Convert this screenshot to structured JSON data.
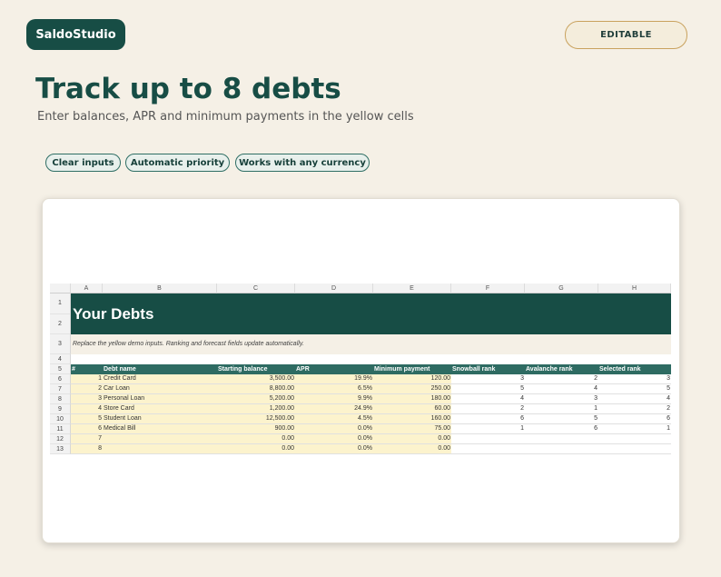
{
  "brand": "SaldoStudio",
  "badge": "EDITABLE",
  "headline": "Track up to 8 debts",
  "subheadline": "Enter balances, APR and minimum payments in the yellow cells",
  "chips": [
    "Clear inputs",
    "Automatic priority",
    "Works with any currency"
  ],
  "sheet": {
    "columns": [
      "A",
      "B",
      "C",
      "D",
      "E",
      "F",
      "G",
      "H"
    ],
    "title": "Your Debts",
    "note": "Replace the yellow demo inputs. Ranking and forecast fields update automatically.",
    "headers": [
      "#",
      "Debt name",
      "Starting balance",
      "APR",
      "Minimum payment",
      "Snowball rank",
      "Avalanche rank",
      "Selected rank"
    ],
    "row_numbers": [
      "1",
      "2",
      "3",
      "4",
      "5"
    ],
    "rows": [
      {
        "rn": "6",
        "n": "1",
        "name": "Credit Card",
        "balance": "3,500.00",
        "apr": "19.9%",
        "min": "120.00",
        "snow": "3",
        "aval": "2",
        "sel": "3"
      },
      {
        "rn": "7",
        "n": "2",
        "name": "Car Loan",
        "balance": "8,800.00",
        "apr": "6.5%",
        "min": "250.00",
        "snow": "5",
        "aval": "4",
        "sel": "5"
      },
      {
        "rn": "8",
        "n": "3",
        "name": "Personal Loan",
        "balance": "5,200.00",
        "apr": "9.9%",
        "min": "180.00",
        "snow": "4",
        "aval": "3",
        "sel": "4"
      },
      {
        "rn": "9",
        "n": "4",
        "name": "Store Card",
        "balance": "1,200.00",
        "apr": "24.9%",
        "min": "60.00",
        "snow": "2",
        "aval": "1",
        "sel": "2"
      },
      {
        "rn": "10",
        "n": "5",
        "name": "Student Loan",
        "balance": "12,500.00",
        "apr": "4.5%",
        "min": "160.00",
        "snow": "6",
        "aval": "5",
        "sel": "6"
      },
      {
        "rn": "11",
        "n": "6",
        "name": "Medical Bill",
        "balance": "900.00",
        "apr": "0.0%",
        "min": "75.00",
        "snow": "1",
        "aval": "6",
        "sel": "1"
      },
      {
        "rn": "12",
        "n": "7",
        "name": "",
        "balance": "0.00",
        "apr": "0.0%",
        "min": "0.00",
        "snow": "",
        "aval": "",
        "sel": ""
      },
      {
        "rn": "13",
        "n": "8",
        "name": "",
        "balance": "0.00",
        "apr": "0.0%",
        "min": "0.00",
        "snow": "",
        "aval": "",
        "sel": ""
      }
    ]
  },
  "colors": {
    "brand": "#174d45",
    "header_fill": "#2e6b62",
    "input_fill": "#fcf3cd",
    "background": "#f5f0e6"
  }
}
